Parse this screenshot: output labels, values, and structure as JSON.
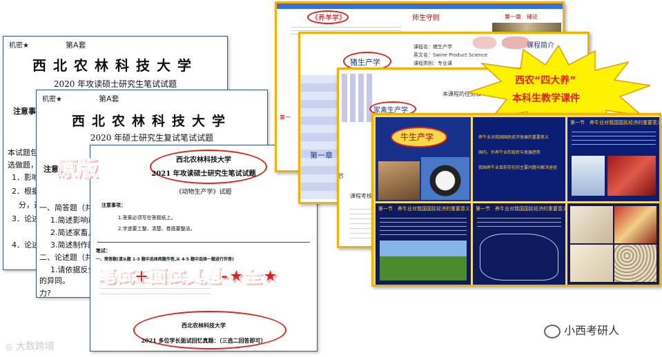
{
  "paper1": {
    "corner": "机密★",
    "set": "第A套",
    "university": "西北农林科技大学",
    "subtitle": "2020 年攻读硕士研究生笔试试题",
    "notes_label": "注意事项",
    "lines": [
      "本试题包括",
      "选做题，任",
      "1．影响奶",
      "2．根据生产",
      "分，选",
      "3．论述降",
      "4．论述家"
    ]
  },
  "paper2": {
    "corner": "机密★",
    "set": "第A套",
    "university": "西北农林科技大学",
    "subtitle": "2020 年硕士研究生复试笔试试题",
    "notes_label": "注意事项",
    "lines": [
      "一、简答题（共",
      "1.简述影响动",
      "2.简述家畜人",
      "3.简述制作配",
      "二、论述题（共",
      "1.请依据反刍",
      "的异同。",
      "2.论述影响割",
      "力?"
    ]
  },
  "paper3": {
    "university": "西北农林科技大学",
    "title": "2021 年攻读硕士研究生笔试试题",
    "course": "《动物生产学》试题",
    "notes_label": "注意事项：",
    "note1": "1.答案必须写在答题纸上。",
    "note2": "2.字迹要工整、清楚、卷面要整洁。",
    "section_label": "笔试：",
    "section1": "一、简答题(请从题 1-3 题中选择两题作答,从 4-5 题中选择一题进行作答)",
    "bottom_university": "西北农林科技大学",
    "bottom_title": "2021 多位学长面试回忆真题：（三选二回答即可）"
  },
  "overlays": {
    "yuanban": "原版",
    "exam_banner": "笔试+面试真题-★全★"
  },
  "slide1": {
    "title": "《养羊学》",
    "center": "师生守则",
    "chapter": "第一章　绪论"
  },
  "slide2": {
    "title": "猪生产学",
    "intro": "课程简介",
    "line1": "课程名：猪生产学",
    "line2": "英文名：Swine Product Science",
    "line3": "课程类别：专业课"
  },
  "slide3": {
    "title": "家禽生产学",
    "task": "本课程的任务和",
    "chapter": "第一章",
    "section1": "第一节",
    "section2": "第二节",
    "exam": "课程考核"
  },
  "starburst": {
    "line1": "西农“四大养”",
    "line2": "本科生教学课件"
  },
  "slide4": {
    "title": "牛生产学",
    "point1": "养牛业对我国国民经济发展的重要意义",
    "point2": "国内、外养牛业的现状与发展趋势",
    "point3": "我国养牛业目前存在的主要问题与解决途径",
    "panel_header": "第一节　养牛业对我国国民经济的重要意义"
  },
  "watermarks": {
    "left": "大数跨境",
    "right": "小西考研人"
  },
  "colors": {
    "accent_red": "#e02020",
    "slide_border": "#f0b400",
    "panel_navy": "#0d1b5e",
    "starburst_fill": "#fff200"
  }
}
